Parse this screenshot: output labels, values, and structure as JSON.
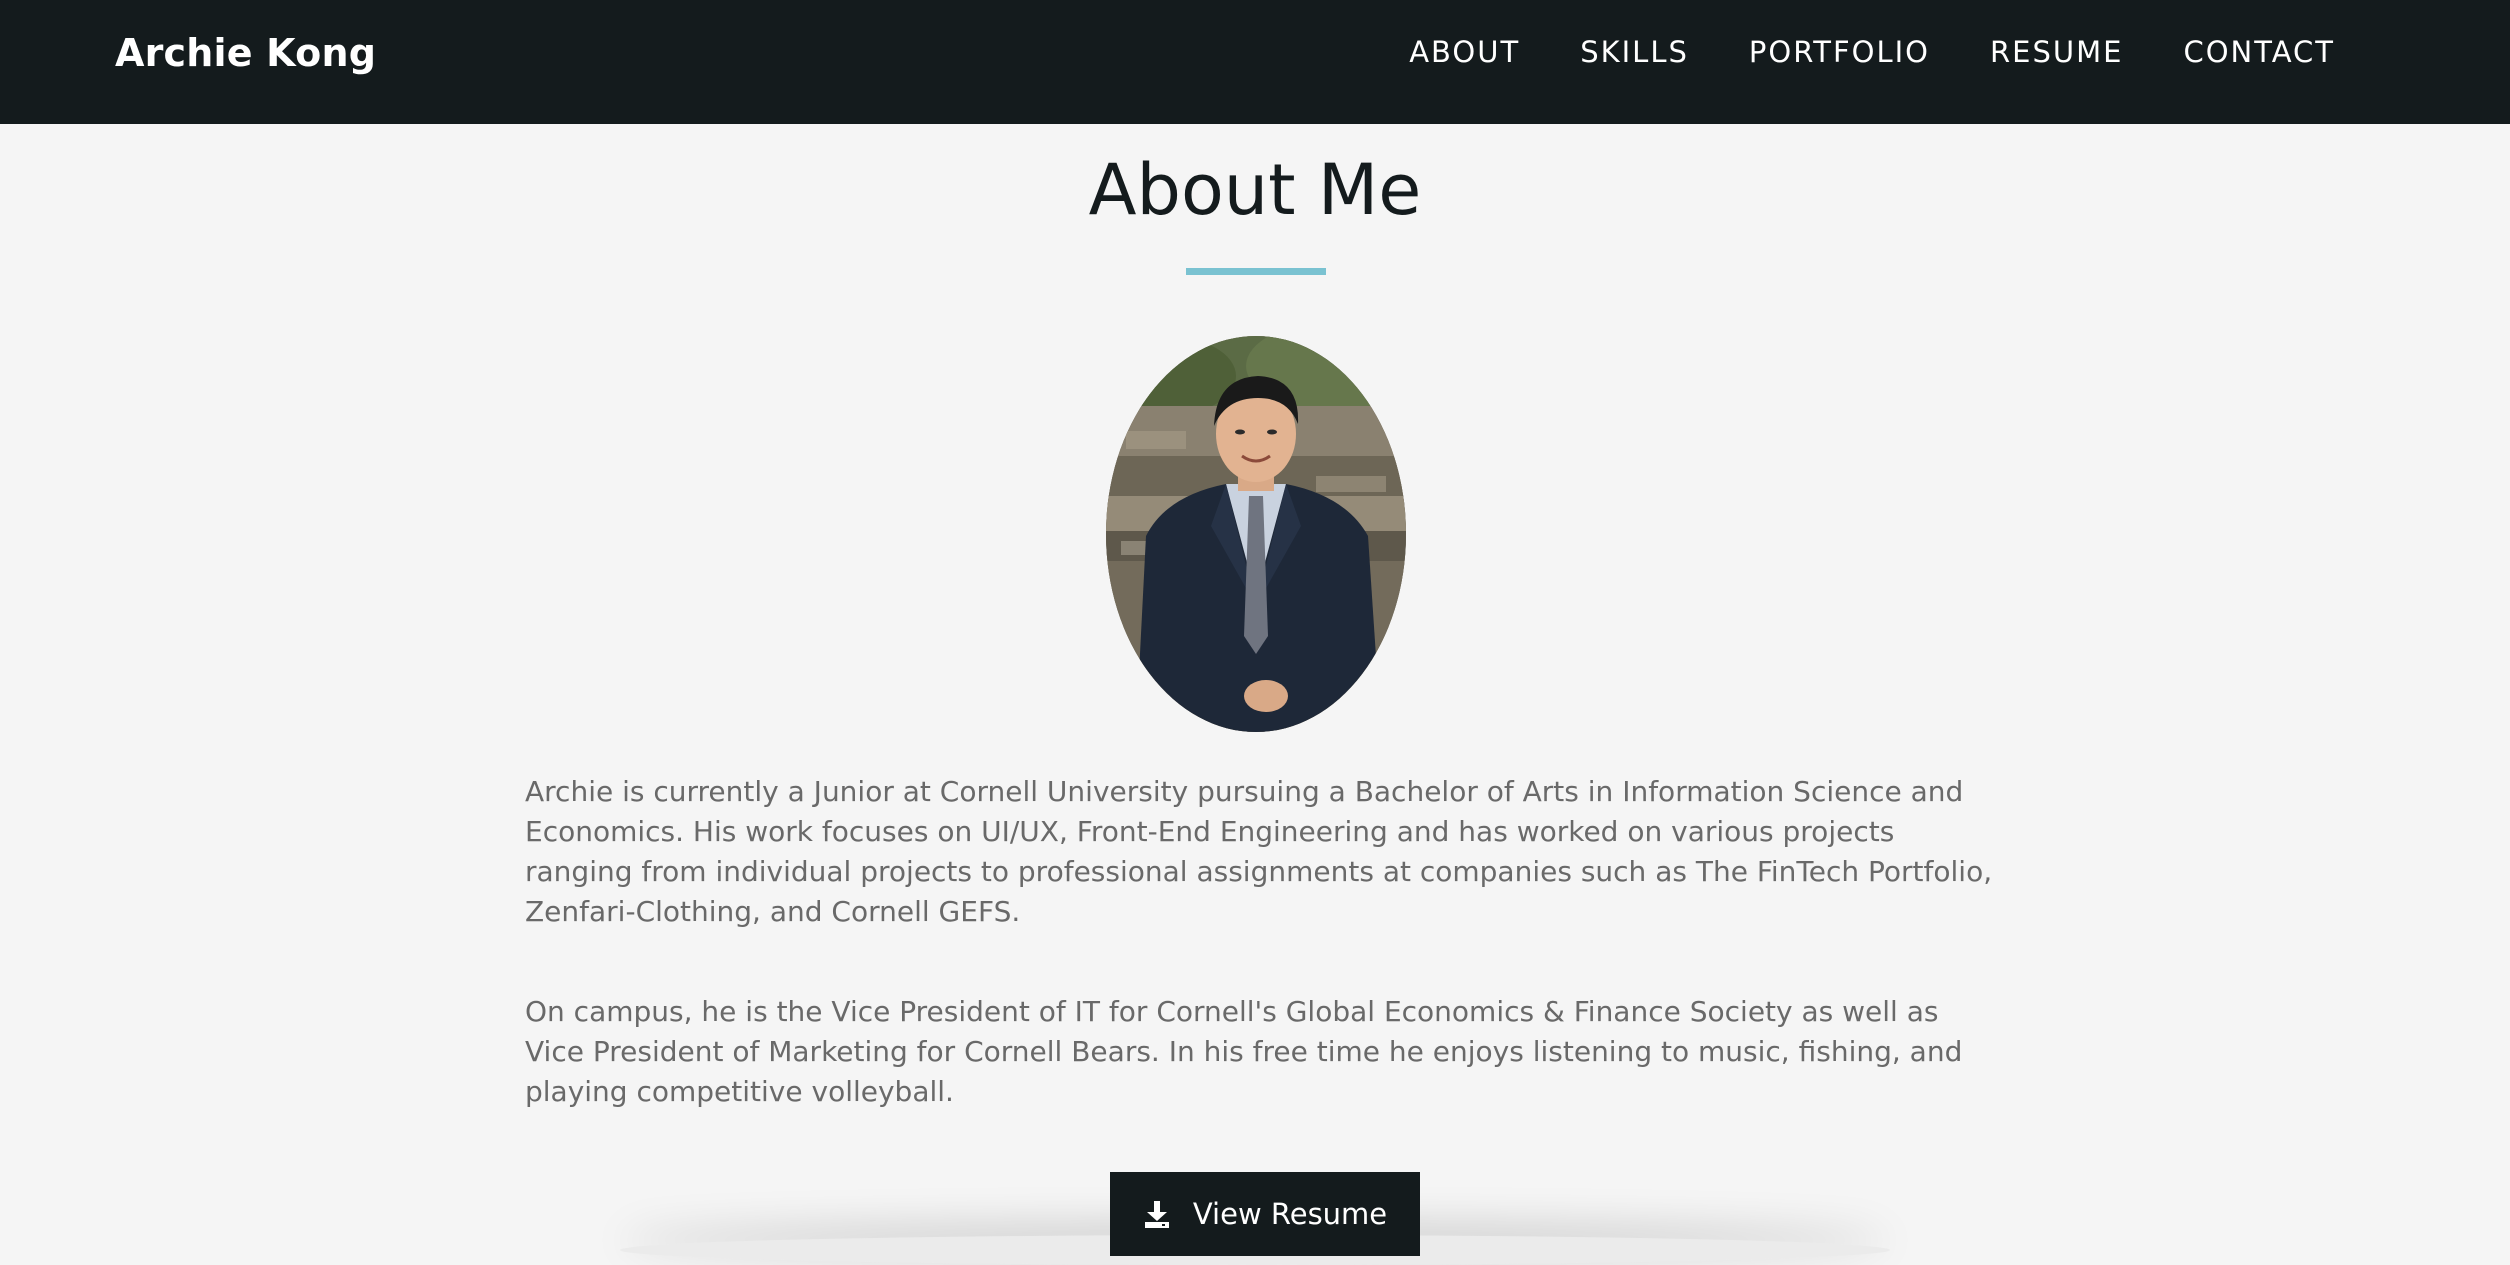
{
  "nav": {
    "brand": "Archie Kong",
    "links": [
      {
        "label": "ABOUT"
      },
      {
        "label": "SKILLS"
      },
      {
        "label": "PORTFOLIO"
      },
      {
        "label": "RESUME"
      },
      {
        "label": "CONTACT"
      }
    ]
  },
  "about": {
    "title": "About Me",
    "accent_color": "#7ac2d1",
    "portrait_alt": "Portrait of Archie Kong",
    "paragraphs": [
      "Archie is currently a Junior at Cornell University pursuing a Bachelor of Arts in Information Science and Economics. His work focuses on UI/UX, Front-End Engineering and has worked on various projects ranging from individual projects to professional assignments at companies such as The FinTech Portfolio, Zenfari-Clothing, and Cornell GEFS.",
      "On campus, he is the Vice President of IT for Cornell's Global Economics & Finance Society as well as Vice President of Marketing for Cornell Bears. In his free time he enjoys listening to music, fishing, and playing competitive volleyball."
    ],
    "resume_button": {
      "icon": "download-icon",
      "label": "View Resume"
    }
  },
  "colors": {
    "navbar_bg": "#141b1d",
    "page_bg": "#f5f5f5",
    "body_text": "#696969"
  }
}
